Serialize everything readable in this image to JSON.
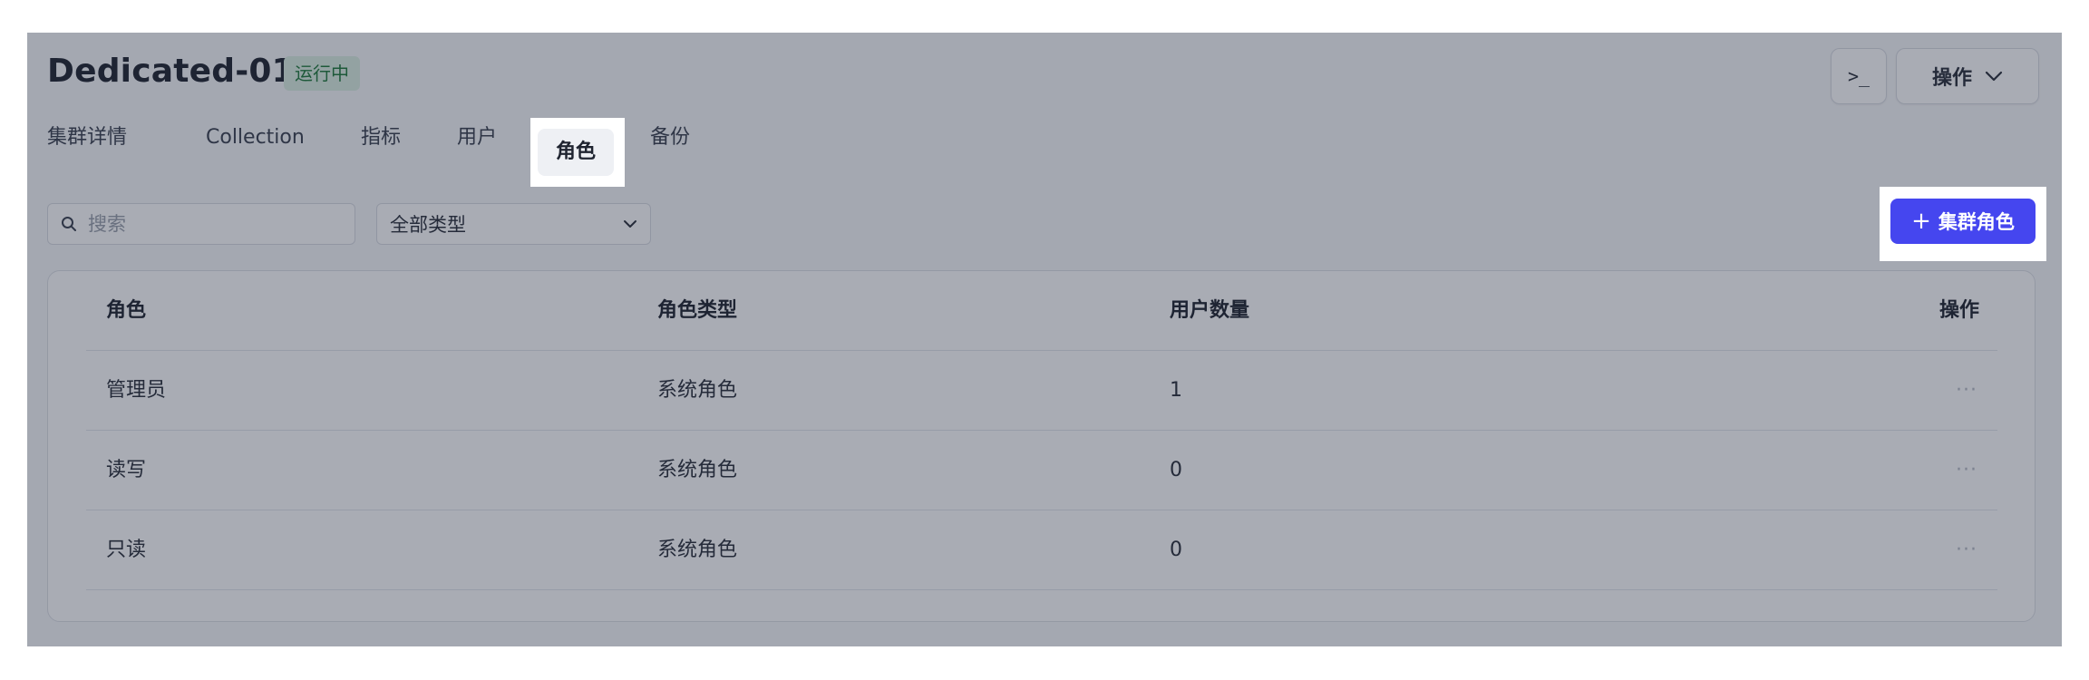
{
  "header": {
    "title": "Dedicated-01",
    "status": "运行中",
    "terminal_label": ">_",
    "actions_label": "操作"
  },
  "tabs": [
    {
      "label": "集群详情",
      "active": false
    },
    {
      "label": "Collection",
      "active": false
    },
    {
      "label": "指标",
      "active": false
    },
    {
      "label": "用户",
      "active": false
    },
    {
      "label": "角色",
      "active": true
    },
    {
      "label": "备份",
      "active": false
    }
  ],
  "toolbar": {
    "search_placeholder": "搜索",
    "type_select_value": "全部类型",
    "add_role_label": "集群角色",
    "add_role_plus": "+"
  },
  "table": {
    "columns": [
      "角色",
      "角色类型",
      "用户数量",
      "操作"
    ],
    "rows": [
      {
        "role": "管理员",
        "type": "系统角色",
        "users": "1",
        "actions": "···"
      },
      {
        "role": "读写",
        "type": "系统角色",
        "users": "0",
        "actions": "···"
      },
      {
        "role": "只读",
        "type": "系统角色",
        "users": "0",
        "actions": "···"
      }
    ]
  },
  "colors": {
    "accent": "#4546ef",
    "status_bg": "#dcefe2",
    "status_text": "#1f7a3b"
  },
  "icons": {
    "search": "search-icon",
    "chevron": "chevron-down-icon",
    "terminal": "terminal-icon",
    "more": "more-icon"
  }
}
